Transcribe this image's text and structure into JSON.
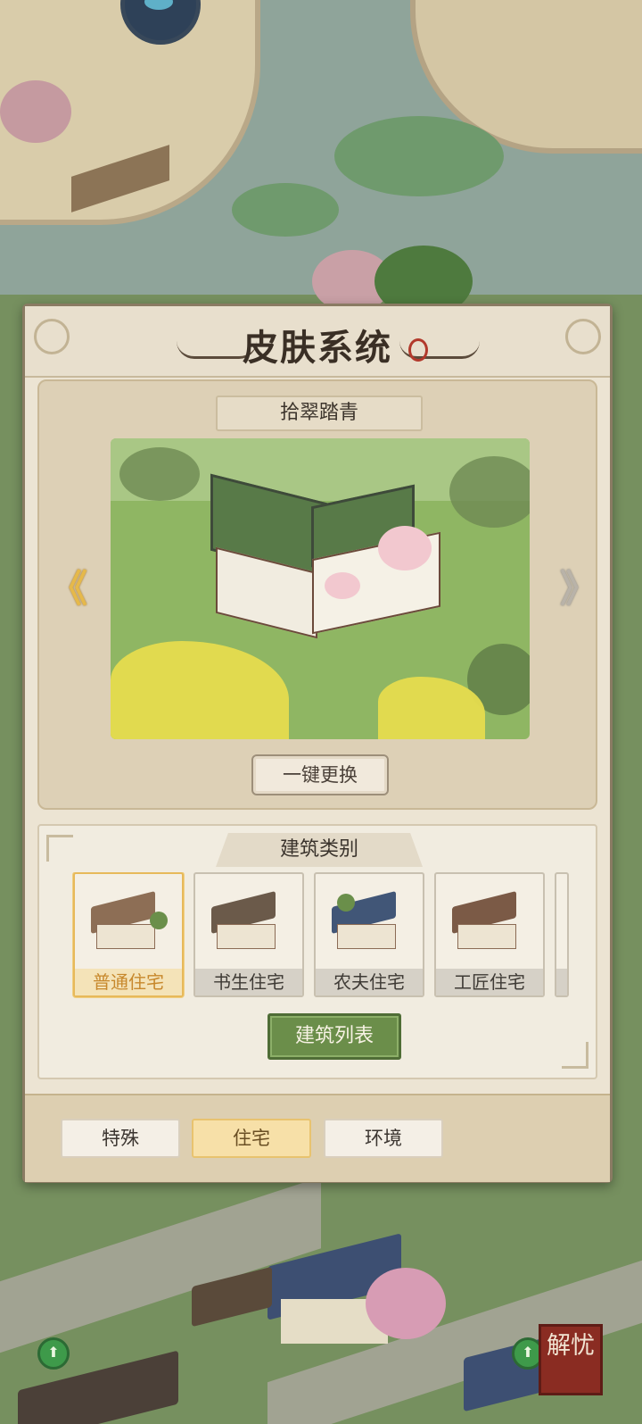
{
  "panel": {
    "title": "皮肤系统",
    "skin_name": "拾翠踏青",
    "replace_button": "一键更换",
    "category_title": "建筑类别",
    "building_cards": [
      {
        "label": "普通住宅",
        "selected": true,
        "roof_color": "#8d6e55"
      },
      {
        "label": "书生住宅",
        "selected": false,
        "roof_color": "#6b5a4a"
      },
      {
        "label": "农夫住宅",
        "selected": false,
        "roof_color": "#415677"
      },
      {
        "label": "工匠住宅",
        "selected": false,
        "roof_color": "#7b5a46"
      }
    ],
    "list_button": "建筑列表",
    "tabs": [
      {
        "label": "特殊",
        "active": false
      },
      {
        "label": "住宅",
        "active": true
      },
      {
        "label": "环境",
        "active": false
      }
    ],
    "prev_arrow": "《",
    "next_arrow": "》"
  },
  "corner_seal": "解忧",
  "colors": {
    "accent_gold": "#e7b95a",
    "button_green": "#6b8e4a",
    "seal_red": "#8a2c22"
  }
}
